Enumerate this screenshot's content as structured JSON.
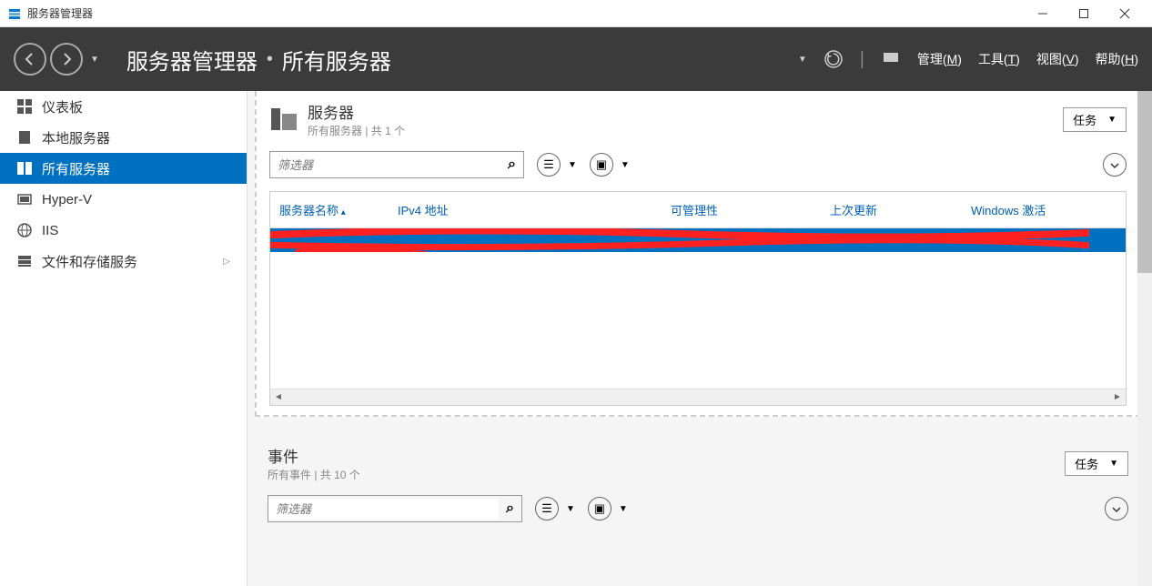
{
  "window": {
    "title": "服务器管理器"
  },
  "breadcrumb": {
    "root": "服务器管理器",
    "current": "所有服务器"
  },
  "header_menu": {
    "manage": "管理(M)",
    "tools": "工具(T)",
    "view": "视图(V)",
    "help": "帮助(H)"
  },
  "sidebar": {
    "items": [
      {
        "label": "仪表板",
        "icon": "dashboard"
      },
      {
        "label": "本地服务器",
        "icon": "server"
      },
      {
        "label": "所有服务器",
        "icon": "servers",
        "active": true
      },
      {
        "label": "Hyper-V",
        "icon": "hyperv"
      },
      {
        "label": "IIS",
        "icon": "iis"
      },
      {
        "label": "文件和存储服务",
        "icon": "storage",
        "expandable": true
      }
    ]
  },
  "servers_section": {
    "title": "服务器",
    "subtitle": "所有服务器 | 共 1 个",
    "tasks_label": "任务",
    "filter_placeholder": "筛选器",
    "columns": {
      "name": "服务器名称",
      "ipv4": "IPv4 地址",
      "manageability": "可管理性",
      "last_update": "上次更新",
      "activation": "Windows 激活"
    }
  },
  "events_section": {
    "title": "事件",
    "subtitle": "所有事件 | 共 10 个",
    "tasks_label": "任务",
    "filter_placeholder": "筛选器"
  }
}
